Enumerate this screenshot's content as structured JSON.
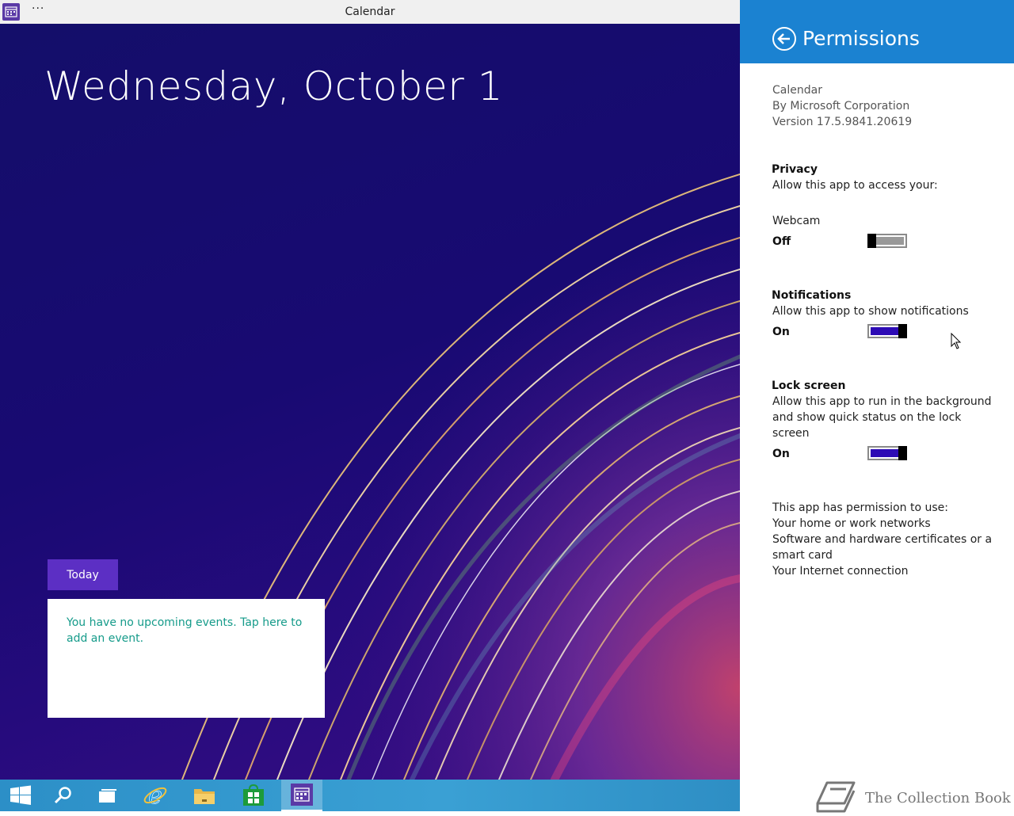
{
  "window": {
    "title": "Calendar",
    "more_label": "···"
  },
  "main": {
    "date_heading": "Wednesday, October 1",
    "today_button": "Today",
    "events_message": "You have no upcoming events. Tap here to add an event."
  },
  "taskbar": {
    "items": [
      "start-icon",
      "search-icon",
      "task-view-icon",
      "internet-explorer-icon",
      "file-explorer-icon",
      "store-icon",
      "calendar-icon"
    ]
  },
  "panel": {
    "title": "Permissions",
    "app_name": "Calendar",
    "publisher": "By Microsoft Corporation",
    "version": "Version 17.5.9841.20619",
    "privacy": {
      "heading": "Privacy",
      "description": "Allow this app to access your:",
      "webcam_label": "Webcam",
      "webcam_state": "Off"
    },
    "notifications": {
      "heading": "Notifications",
      "description": "Allow this app to show notifications",
      "state": "On"
    },
    "lock_screen": {
      "heading": "Lock screen",
      "description_lines": [
        "Allow this app to run in the background",
        "and show quick status on the lock",
        "screen"
      ],
      "state": "On"
    },
    "permissions": {
      "heading": "This app has permission to use:",
      "items": [
        "Your home or work networks",
        "Software and hardware certificates or a",
        "smart card",
        "Your Internet connection"
      ]
    },
    "watermark": "The Collection Book"
  },
  "colors": {
    "accent": "#1b82d1",
    "toggle_on": "#2d0bb5",
    "today_button": "#5c2fc4",
    "event_text": "#159b8a"
  }
}
